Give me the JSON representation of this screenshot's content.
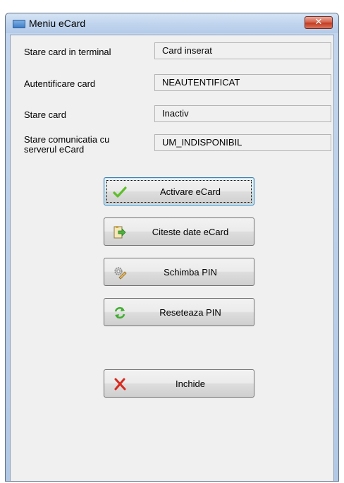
{
  "window": {
    "title": "Meniu eCard",
    "close_glyph": "✕"
  },
  "status_rows": [
    {
      "label": "Stare card in terminal",
      "value": "Card inserat"
    },
    {
      "label": "Autentificare card",
      "value": "NEAUTENTIFICAT"
    },
    {
      "label": "Stare card",
      "value": "Inactiv"
    },
    {
      "label": "Stare comunicatia cu serverul eCard",
      "value": "UM_INDISPONIBIL"
    }
  ],
  "buttons": {
    "activate": {
      "label": "Activare eCard",
      "icon": "checkmark-icon"
    },
    "read": {
      "label": "Citeste date eCard",
      "icon": "read-data-icon"
    },
    "change_pin": {
      "label": "Schimba PIN",
      "icon": "gear-pencil-icon"
    },
    "reset_pin": {
      "label": "Reseteaza PIN",
      "icon": "refresh-arrows-icon"
    },
    "close": {
      "label": "Inchide",
      "icon": "red-x-icon"
    }
  },
  "colors": {
    "check_green": "#5fbf2a",
    "arrow_green": "#3fae2f",
    "close_red": "#d82a1f"
  }
}
